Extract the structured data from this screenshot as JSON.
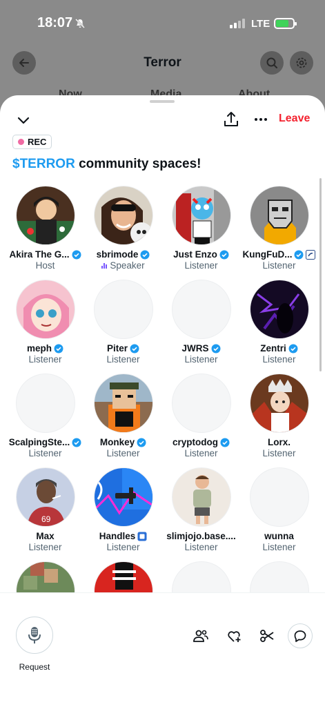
{
  "status_bar": {
    "time": "18:07",
    "network": "LTE"
  },
  "background_app": {
    "title": "Terror",
    "tabs": [
      "Now",
      "Media",
      "About"
    ]
  },
  "sheet": {
    "leave_label": "Leave",
    "rec_label": "REC",
    "title_cashtag": "$TERROR",
    "title_rest": " community spaces!",
    "request_label": "Request"
  },
  "participants": [
    {
      "name": "Akira The G...",
      "role": "Host",
      "verified": true
    },
    {
      "name": "sbrimode",
      "role": "Speaker",
      "verified": true
    },
    {
      "name": "Just Enzo",
      "role": "Listener",
      "verified": true
    },
    {
      "name": "KungFuD...",
      "role": "Listener",
      "verified": true
    },
    {
      "name": "meph",
      "role": "Listener",
      "verified": true
    },
    {
      "name": "Piter",
      "role": "Listener",
      "verified": true
    },
    {
      "name": "JWRS",
      "role": "Listener",
      "verified": true
    },
    {
      "name": "Zentri",
      "role": "Listener",
      "verified": true
    },
    {
      "name": "ScalpingSte...",
      "role": "Listener",
      "verified": true
    },
    {
      "name": "Monkey",
      "role": "Listener",
      "verified": true
    },
    {
      "name": "cryptodog",
      "role": "Listener",
      "verified": true
    },
    {
      "name": "Lorx.",
      "role": "Listener",
      "verified": false
    },
    {
      "name": "Max",
      "role": "Listener",
      "verified": false
    },
    {
      "name": "Handles",
      "role": "Listener",
      "verified": false
    },
    {
      "name": "slimjojo.base....",
      "role": "Listener",
      "verified": false
    },
    {
      "name": "wunna",
      "role": "Listener",
      "verified": false
    }
  ],
  "colors": {
    "accent": "#1d9bf0",
    "leave": "#f4212e",
    "speaker": "#7856ff"
  }
}
